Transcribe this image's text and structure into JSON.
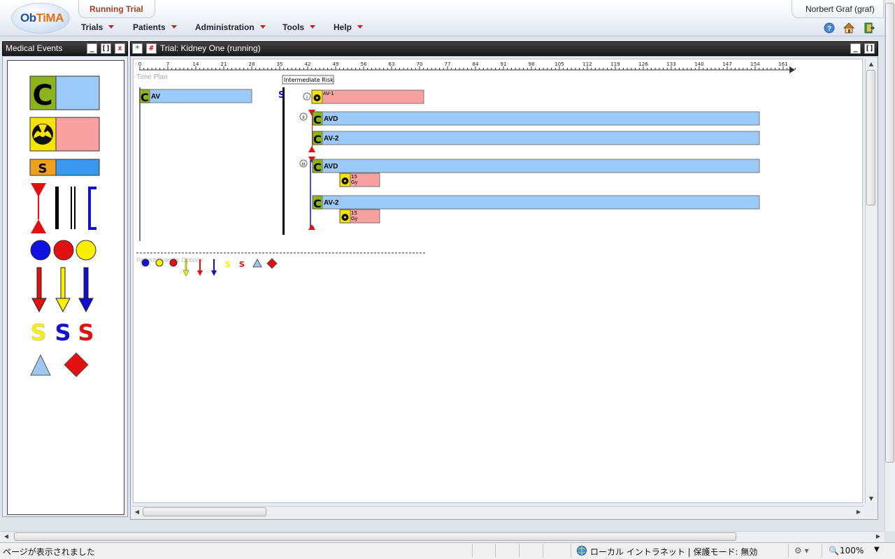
{
  "app": {
    "logo_text_a": "Ob",
    "logo_text_b": "TiMA",
    "active_tab": "Running Trial",
    "user": "Norbert Graf (graf)"
  },
  "menu": [
    {
      "label": "Trials"
    },
    {
      "label": "Patients"
    },
    {
      "label": "Administration"
    },
    {
      "label": "Tools"
    },
    {
      "label": "Help"
    }
  ],
  "header_icons": [
    "help-icon",
    "home-icon",
    "exit-icon"
  ],
  "left_panel": {
    "title": "Medical Events",
    "buttons": {
      "minimize": "_",
      "maximize": "[]",
      "close": "x"
    },
    "palette": {
      "chemo_letter": "C",
      "surgery_letter": "S",
      "s_letters": [
        "S",
        "S",
        "S"
      ]
    }
  },
  "main_panel": {
    "title": "Trial: Kidney One (running)",
    "buttons": {
      "add": "*",
      "grid": "#",
      "minimize": "_",
      "maximize": "[]"
    },
    "time_plan_label": "Time Plan",
    "patient_options_label": "Patient Specific Options",
    "intermediate_risk_label": "Intermediate Risk",
    "surgery_marker": "S",
    "ruler_ticks": [
      0,
      7,
      14,
      21,
      28,
      35,
      42,
      49,
      56,
      63,
      70,
      77,
      84,
      91,
      98,
      105,
      112,
      119,
      126,
      133,
      140,
      147,
      154,
      161
    ],
    "stage_labels": [
      "I",
      "II",
      "III"
    ],
    "chemo_letter": "C",
    "regimen_av": "AV",
    "regimen_av1": "AV-1",
    "regimen_avd": "AVD",
    "regimen_av2": "AV-2",
    "dose_value": "15",
    "dose_unit": "Gy",
    "options_s": [
      "S",
      "S"
    ]
  },
  "colors": {
    "chemo_green": "#8db31c",
    "chemo_blue": "#9ccaf8",
    "radio_yellow": "#f5e400",
    "radio_pink": "#f9a0a0",
    "surgery_orange": "#f0a020",
    "surgery_blue": "#3b98ee",
    "red": "#e21010",
    "blue": "#1010d0",
    "yellow": "#f8f000",
    "triangle_blue": "#9cc8f0"
  },
  "status": {
    "left": "ページが表示されました",
    "zone": "ローカル イントラネット | 保護モード: 無効",
    "zoom": "100%"
  }
}
